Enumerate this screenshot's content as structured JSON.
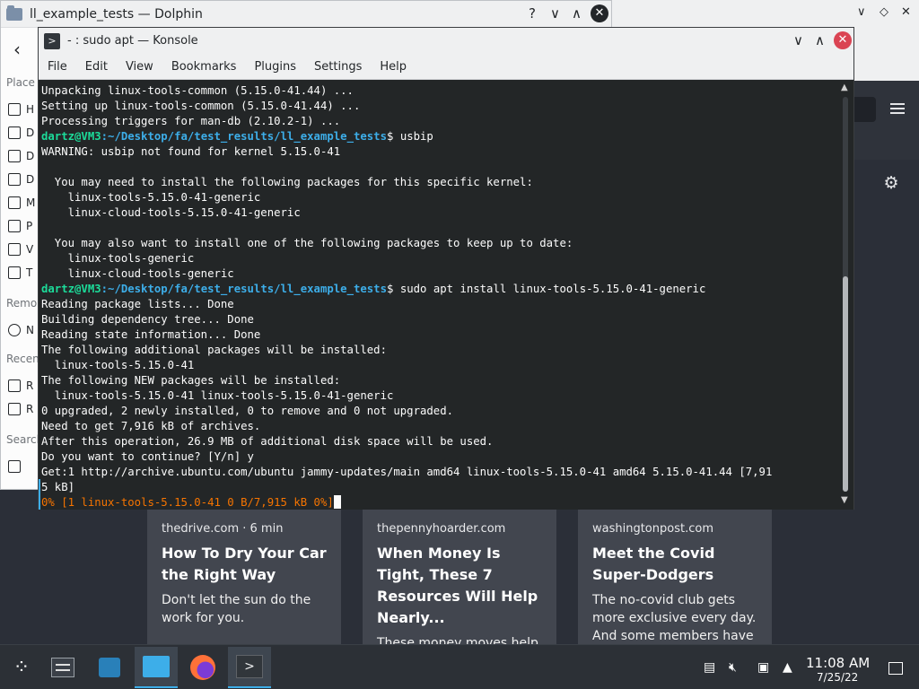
{
  "browser": {
    "settings_icon": "gear-icon",
    "menu_icon": "hamburger-icon",
    "cards": [
      {
        "source": "thedrive.com · 6 min",
        "headline": "How To Dry Your Car the Right Way",
        "description": "Don't let the sun do the work for you."
      },
      {
        "source": "thepennyhoarder.com",
        "headline": "When Money Is Tight, These 7 Resources Will Help Nearly...",
        "description": "These money moves help people when they're in a pinch."
      },
      {
        "source": "washingtonpost.com",
        "headline": "Meet the Covid Super-Dodgers",
        "description": "The no-covid club gets more exclusive every day. And some members have no id..."
      }
    ]
  },
  "dolphin": {
    "title": "ll_example_tests — Dolphin",
    "buttons": {
      "help": "?",
      "minimize": "∨",
      "maximize": "∧",
      "close": "✕"
    },
    "sidebar": {
      "places_heading": "Place",
      "remote_heading": "Remo",
      "recent_heading": "Recen",
      "search_heading": "Search",
      "items": [
        "H",
        "D",
        "D",
        "D",
        "M",
        "P",
        "V",
        "T",
        "N",
        "R",
        "R",
        ""
      ]
    }
  },
  "konsole": {
    "title": "- : sudo apt — Konsole",
    "buttons": {
      "minimize": "∨",
      "maximize": "∧",
      "close": "✕"
    },
    "menu": [
      "File",
      "Edit",
      "View",
      "Bookmarks",
      "Plugins",
      "Settings",
      "Help"
    ],
    "prompt": {
      "user_host": "dartz@VM3",
      "path": ":~/Desktop/fa/test_results/ll_example_tests",
      "symbol": "$"
    },
    "lines": [
      "Unpacking linux-tools-common (5.15.0-41.44) ...",
      "Setting up linux-tools-common (5.15.0-41.44) ...",
      "Processing triggers for man-db (2.10.2-1) ...",
      "WARNING: usbip not found for kernel 5.15.0-41",
      "",
      "  You may need to install the following packages for this specific kernel:",
      "    linux-tools-5.15.0-41-generic",
      "    linux-cloud-tools-5.15.0-41-generic",
      "",
      "  You may also want to install one of the following packages to keep up to date:",
      "    linux-tools-generic",
      "    linux-cloud-tools-generic",
      "Reading package lists... Done",
      "Building dependency tree... Done",
      "Reading state information... Done",
      "The following additional packages will be installed:",
      "  linux-tools-5.15.0-41",
      "The following NEW packages will be installed:",
      "  linux-tools-5.15.0-41 linux-tools-5.15.0-41-generic",
      "0 upgraded, 2 newly installed, 0 to remove and 0 not upgraded.",
      "Need to get 7,916 kB of archives.",
      "After this operation, 26.9 MB of additional disk space will be used.",
      "Do you want to continue? [Y/n] y",
      "Get:1 http://archive.ubuntu.com/ubuntu jammy-updates/main amd64 linux-tools-5.15.0-41 amd64 5.15.0-41.44 [7,91",
      "5 kB]"
    ],
    "commands": [
      "usbip",
      "sudo apt install linux-tools-5.15.0-41-generic"
    ],
    "progress": "0% [1 linux-tools-5.15.0-41 0 B/7,915 kB 0%]"
  },
  "taskbar": {
    "time": "11:08 AM",
    "date": "7/25/22",
    "apps": [
      "launcher-icon",
      "pager-icon",
      "discover-icon",
      "files-icon",
      "firefox-icon",
      "konsole-icon"
    ],
    "tray": [
      "clipboard-icon",
      "volume-muted-icon",
      "network-icon",
      "tray-expand-icon",
      "show-desktop-icon"
    ]
  }
}
